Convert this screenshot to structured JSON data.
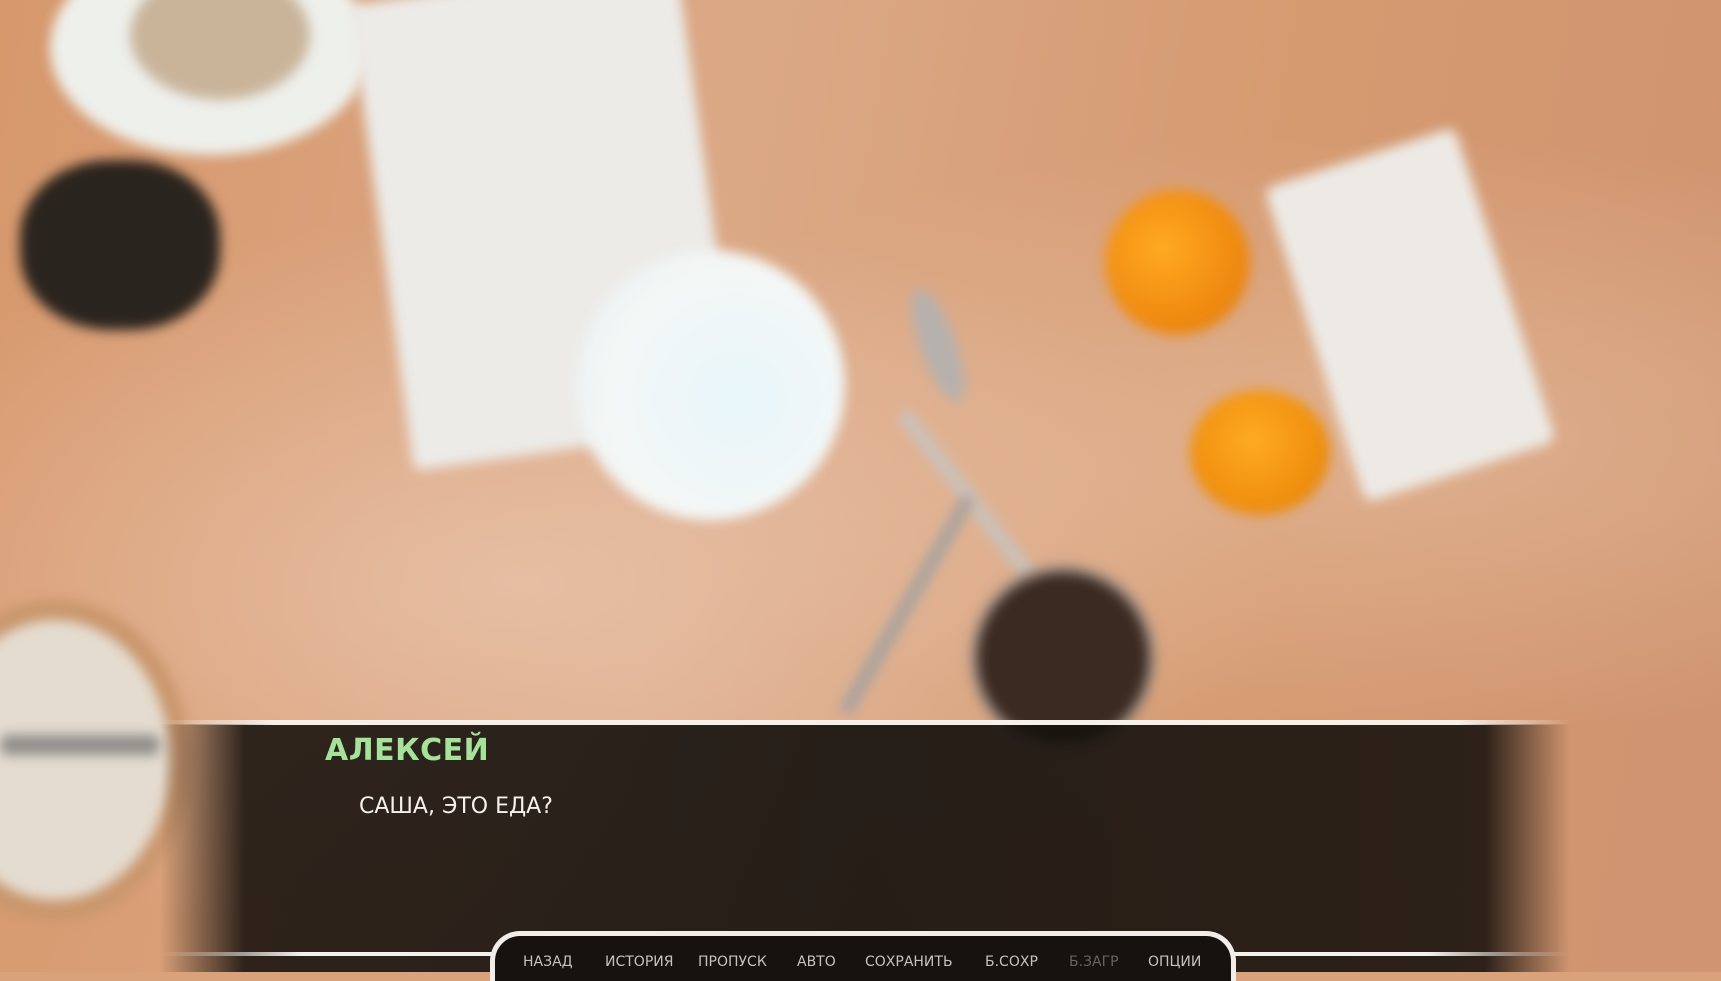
{
  "scene": {
    "description_icon": "table-with-food-background"
  },
  "dialogue": {
    "speaker": "АЛЕКСЕЙ",
    "text": "САША, ЭТО ЕДА?"
  },
  "quick_menu": {
    "back": "НАЗАД",
    "history": "ИСТОРИЯ",
    "skip": "ПРОПУСК",
    "auto": "АВТО",
    "save": "СОХРАНИТЬ",
    "quick_save": "Б.СОХР",
    "quick_load": "Б.ЗАГР",
    "options": "ОПЦИИ"
  },
  "colors": {
    "speaker_name": "#a6e39a",
    "dialogue_text": "#f4f0ec",
    "menu_text": "#c8c1bb",
    "menu_text_disabled": "#6a625c",
    "frame": "#f1ede8"
  }
}
